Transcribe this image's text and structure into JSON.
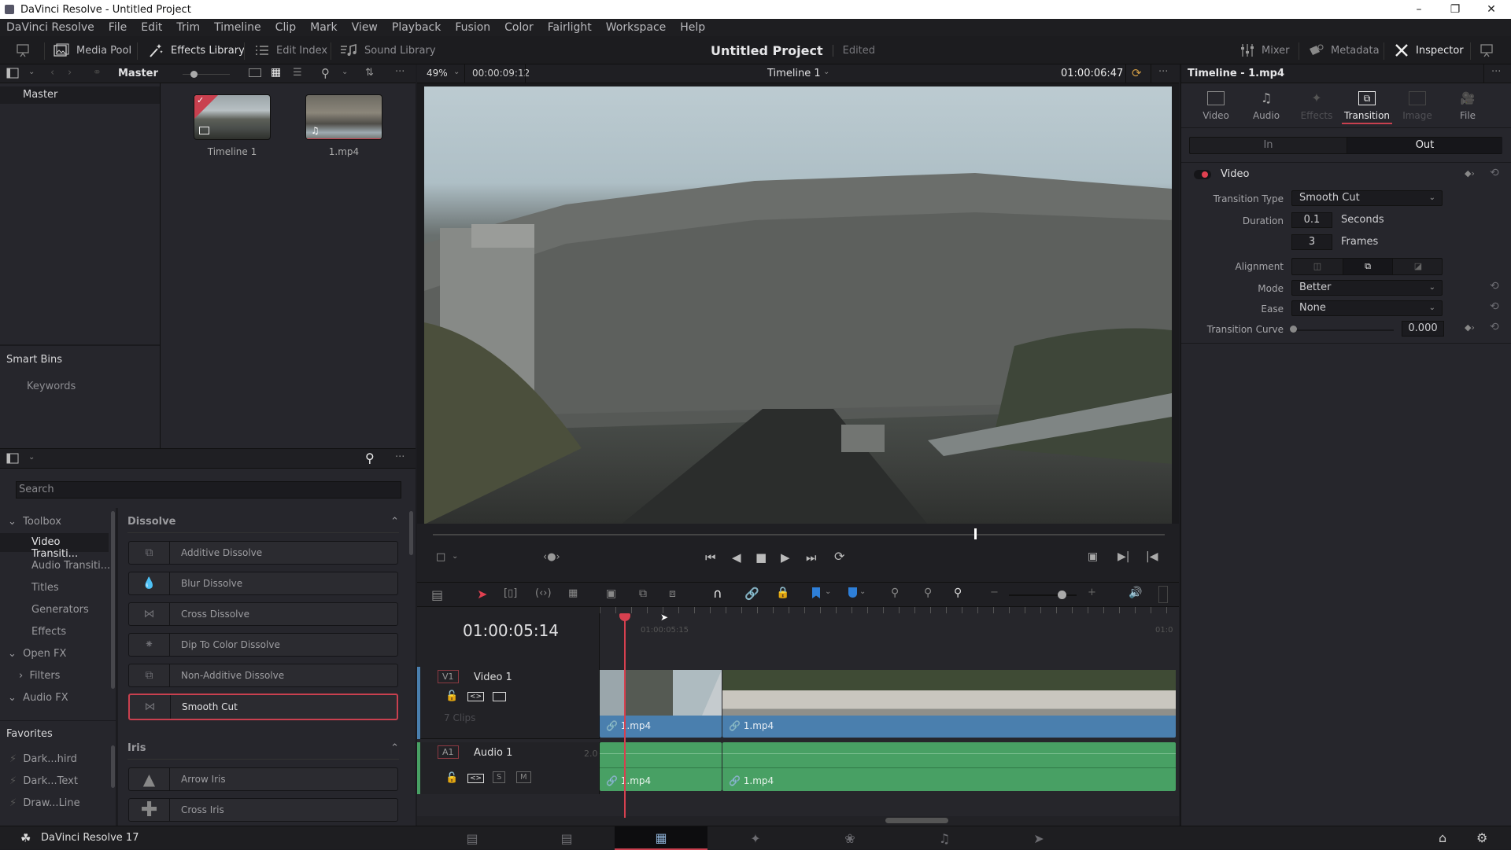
{
  "window": {
    "title": "DaVinci Resolve - Untitled Project",
    "controls": {
      "minimize": "–",
      "restore": "❐",
      "close": "✕"
    }
  },
  "menu": [
    "DaVinci Resolve",
    "File",
    "Edit",
    "Trim",
    "Timeline",
    "Clip",
    "Mark",
    "View",
    "Playback",
    "Fusion",
    "Color",
    "Fairlight",
    "Workspace",
    "Help"
  ],
  "toolbar": {
    "media_pool": "Media Pool",
    "effects_library": "Effects Library",
    "edit_index": "Edit Index",
    "sound_library": "Sound Library",
    "project_title": "Untitled Project",
    "project_status": "Edited",
    "mixer": "Mixer",
    "metadata": "Metadata",
    "inspector": "Inspector"
  },
  "media_pool": {
    "bin_title": "Master",
    "bins": [
      "Master"
    ],
    "smart_bins_header": "Smart Bins",
    "smart_bins": [
      "Keywords"
    ],
    "clips": [
      {
        "name": "Timeline 1",
        "type": "timeline",
        "selected": true
      },
      {
        "name": "1.mp4",
        "type": "video-audio"
      }
    ]
  },
  "effects": {
    "search_placeholder": "Search",
    "tree": [
      {
        "label": "Toolbox",
        "expanded": true,
        "level": 0
      },
      {
        "label": "Video Transiti...",
        "level": 1,
        "selected": true
      },
      {
        "label": "Audio Transiti...",
        "level": 1
      },
      {
        "label": "Titles",
        "level": 1
      },
      {
        "label": "Generators",
        "level": 1
      },
      {
        "label": "Effects",
        "level": 1
      },
      {
        "label": "Open FX",
        "expanded": true,
        "level": 0
      },
      {
        "label": "Filters",
        "level": 1,
        "collapsed": true
      },
      {
        "label": "Audio FX",
        "expanded": true,
        "level": 0
      }
    ],
    "favorites_header": "Favorites",
    "favorites": [
      "Dark...hird",
      "Dark...Text",
      "Draw...Line"
    ],
    "categories": [
      {
        "name": "Dissolve",
        "items": [
          "Additive Dissolve",
          "Blur Dissolve",
          "Cross Dissolve",
          "Dip To Color Dissolve",
          "Non-Additive Dissolve",
          "Smooth Cut"
        ]
      },
      {
        "name": "Iris",
        "items": [
          "Arrow Iris",
          "Cross Iris"
        ]
      }
    ],
    "selected_item": "Smooth Cut"
  },
  "viewer": {
    "zoom": "49%",
    "source_timecode": "00:00:09:12",
    "timeline_name": "Timeline 1",
    "record_timecode": "01:00:06:47",
    "scrubber_position": 0.74
  },
  "timeline": {
    "current_timecode": "01:00:05:14",
    "ruler_labels": [
      "01:00:05:15",
      "01:0"
    ],
    "tracks": [
      {
        "id": "V1",
        "name": "Video 1",
        "info": "7 Clips",
        "clips": [
          "1.mp4",
          "1.mp4"
        ]
      },
      {
        "id": "A1",
        "name": "Audio 1",
        "channels": "2.0",
        "clips": [
          "1.mp4",
          "1.mp4"
        ],
        "solo": "S",
        "mute": "M"
      }
    ],
    "zoom_slider": 0.72
  },
  "inspector": {
    "title": "Timeline - 1.mp4",
    "tabs": [
      {
        "label": "Video",
        "state": "normal"
      },
      {
        "label": "Audio",
        "state": "normal"
      },
      {
        "label": "Effects",
        "state": "disabled"
      },
      {
        "label": "Transition",
        "state": "active"
      },
      {
        "label": "Image",
        "state": "disabled"
      },
      {
        "label": "File",
        "state": "normal"
      }
    ],
    "in_out": {
      "in": "In",
      "out": "Out",
      "selected": "Out"
    },
    "section": "Video",
    "properties": {
      "transition_type_label": "Transition Type",
      "transition_type": "Smooth Cut",
      "duration_label": "Duration",
      "duration_seconds": "0.1",
      "seconds_unit": "Seconds",
      "duration_frames": "3",
      "frames_unit": "Frames",
      "alignment_label": "Alignment",
      "alignment_selected": "center",
      "mode_label": "Mode",
      "mode": "Better",
      "ease_label": "Ease",
      "ease": "None",
      "curve_label": "Transition Curve",
      "curve_value": "0.000"
    }
  },
  "status": {
    "app_name": "DaVinci Resolve 17",
    "pages": [
      "media",
      "cut",
      "edit",
      "fusion",
      "color",
      "fairlight",
      "deliver"
    ],
    "active_page": "edit"
  },
  "colors": {
    "accent_red": "#c9404f",
    "video_clip": "#4a7fae",
    "audio_clip": "#48a064",
    "marker_blue": "#2e7fd8"
  }
}
